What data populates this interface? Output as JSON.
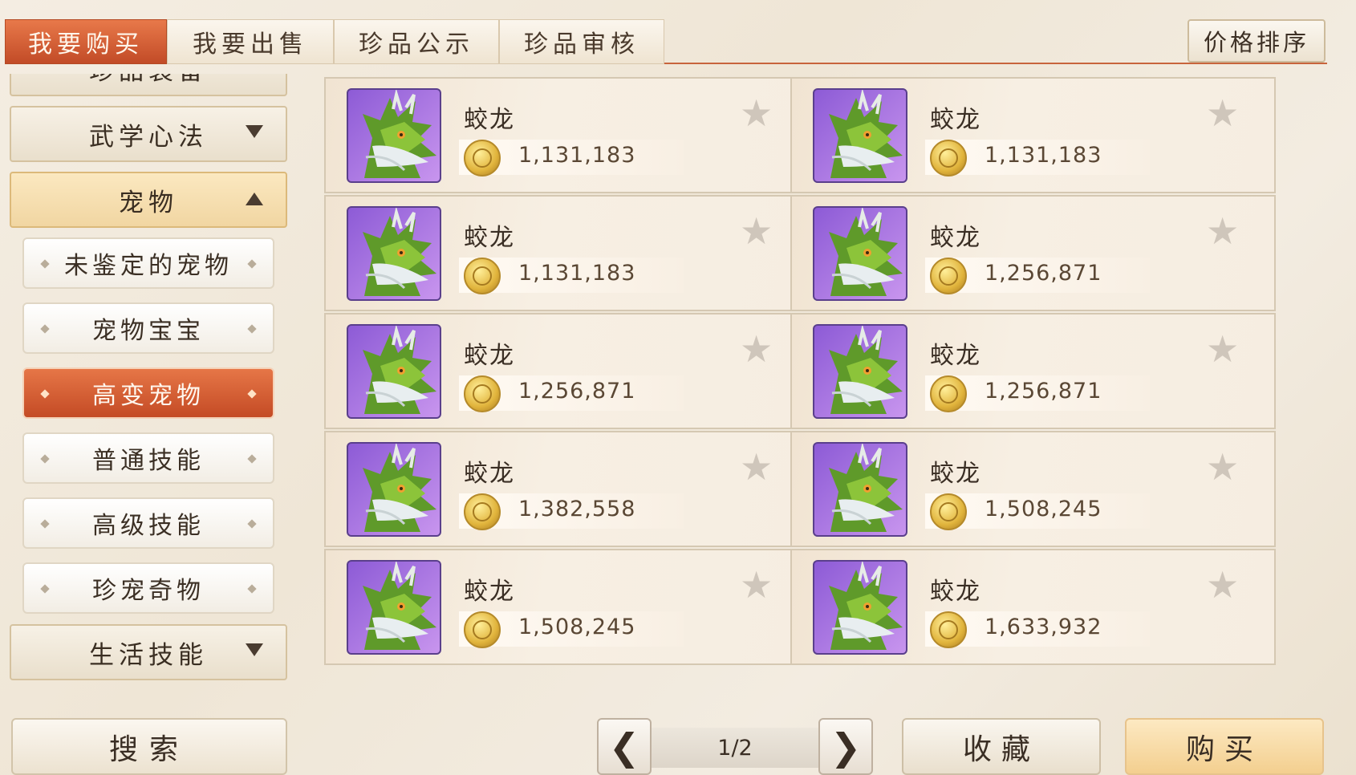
{
  "tabs": [
    {
      "label": "我要购买",
      "active": true
    },
    {
      "label": "我要出售",
      "active": false
    },
    {
      "label": "珍品公示",
      "active": false
    },
    {
      "label": "珍品审核",
      "active": false
    }
  ],
  "sort_button": "价格排序",
  "sidebar": {
    "top_partial_label": "珍品装备",
    "categories": [
      {
        "label": "武学心法",
        "state": "collapsed"
      },
      {
        "label": "宠物",
        "state": "expanded"
      },
      {
        "label": "生活技能",
        "state": "collapsed"
      }
    ],
    "subcategories": [
      {
        "label": "未鉴定的宠物",
        "active": false
      },
      {
        "label": "宠物宝宝",
        "active": false
      },
      {
        "label": "高变宠物",
        "active": true
      },
      {
        "label": "普通技能",
        "active": false
      },
      {
        "label": "高级技能",
        "active": false
      },
      {
        "label": "珍宠奇物",
        "active": false
      }
    ]
  },
  "listings": [
    {
      "name": "蛟龙",
      "price": "1,131,183"
    },
    {
      "name": "蛟龙",
      "price": "1,131,183"
    },
    {
      "name": "蛟龙",
      "price": "1,131,183"
    },
    {
      "name": "蛟龙",
      "price": "1,256,871"
    },
    {
      "name": "蛟龙",
      "price": "1,256,871"
    },
    {
      "name": "蛟龙",
      "price": "1,256,871"
    },
    {
      "name": "蛟龙",
      "price": "1,382,558"
    },
    {
      "name": "蛟龙",
      "price": "1,508,245"
    },
    {
      "name": "蛟龙",
      "price": "1,508,245"
    },
    {
      "name": "蛟龙",
      "price": "1,633,932"
    }
  ],
  "icons": {
    "item": "dragon-pet-icon",
    "currency": "gold-coin-icon",
    "favorite": "star-icon"
  },
  "bottom": {
    "search_label": "搜索",
    "page_indicator": "1/2",
    "favorite_label": "收藏",
    "buy_label": "购买"
  },
  "colors": {
    "accent": "#d25a30",
    "buy": "#f3cf8f",
    "pet_frame": "#9b6ddc"
  }
}
